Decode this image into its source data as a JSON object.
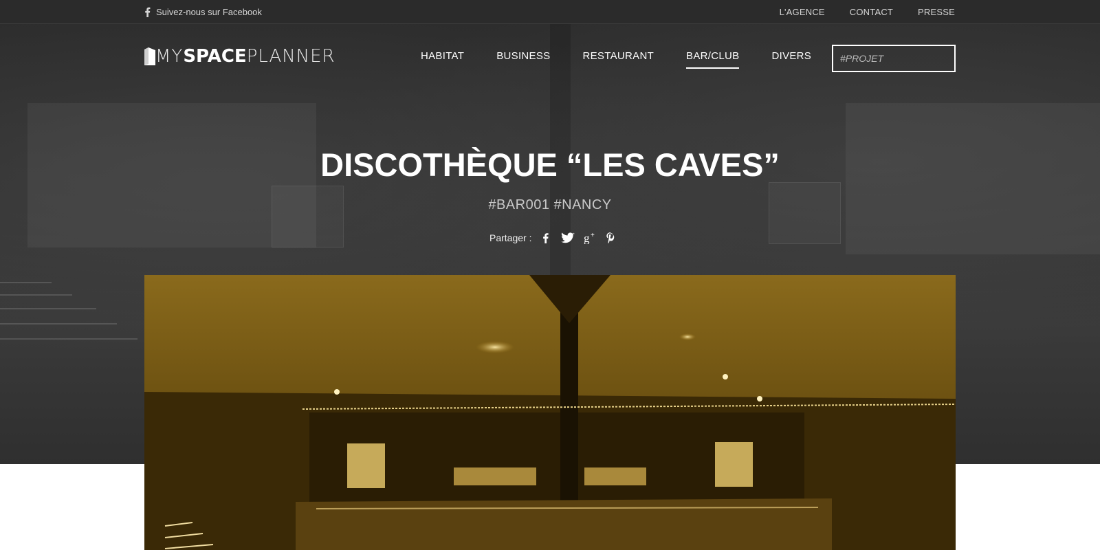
{
  "topbar": {
    "facebook_follow": "Suivez-nous sur Facebook",
    "links": [
      "L'AGENCE",
      "CONTACT",
      "PRESSE"
    ]
  },
  "logo": {
    "my": "MY",
    "space": "SPACE",
    "planner": "PLANNER"
  },
  "nav": {
    "items": [
      "HABITAT",
      "BUSINESS",
      "RESTAURANT",
      "BAR/CLUB",
      "DIVERS"
    ],
    "active": "BAR/CLUB"
  },
  "search": {
    "placeholder": "#PROJET"
  },
  "project": {
    "title": "DISCOTHÈQUE “LES CAVES”",
    "tags": "#BAR001 #NANCY"
  },
  "share": {
    "label": "Partager :",
    "icons": [
      "facebook-icon",
      "twitter-icon",
      "google-plus-icon",
      "pinterest-icon"
    ]
  },
  "colors": {
    "topbar": "#2b2b2b",
    "hero": "#333333",
    "photo_tint": "#6b4d0d"
  }
}
